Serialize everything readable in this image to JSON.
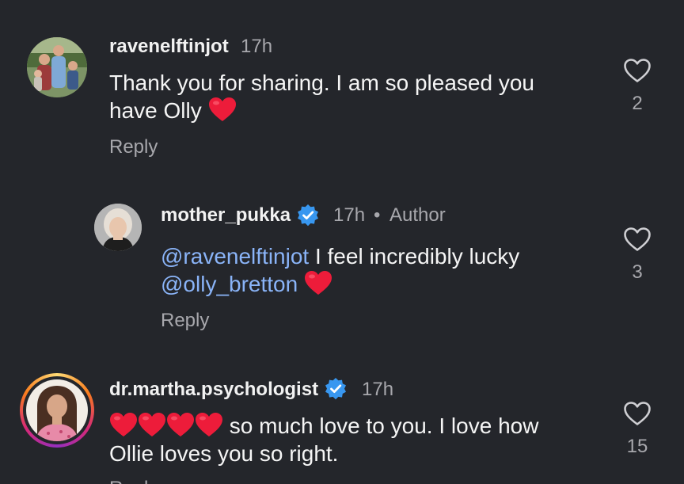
{
  "comments": [
    {
      "username": "ravenelftinjot",
      "time": "17h",
      "text_line1": "Thank you for sharing. I am so pleased you",
      "text_line2": "have Olly",
      "reply_label": "Reply",
      "likes": "2"
    },
    {
      "username": "mother_pukka",
      "time": "17h",
      "author_badge": "Author",
      "mention1": "@ravenelftinjot",
      "text_line1": " I feel incredibly lucky",
      "mention2": "@olly_bretton",
      "reply_label": "Reply",
      "likes": "3"
    },
    {
      "username": "dr.martha.psychologist",
      "time": "17h",
      "text_line1": "so much love to you. I love how",
      "text_line2": "Ollie loves you so right.",
      "reply_label": "Reply",
      "likes": "15"
    }
  ],
  "colors": {
    "background": "#24262b",
    "mention": "#8ab4f8",
    "verified": "#3897f0",
    "heart": "#ed1c3a",
    "story_ring": "#d6249f"
  }
}
